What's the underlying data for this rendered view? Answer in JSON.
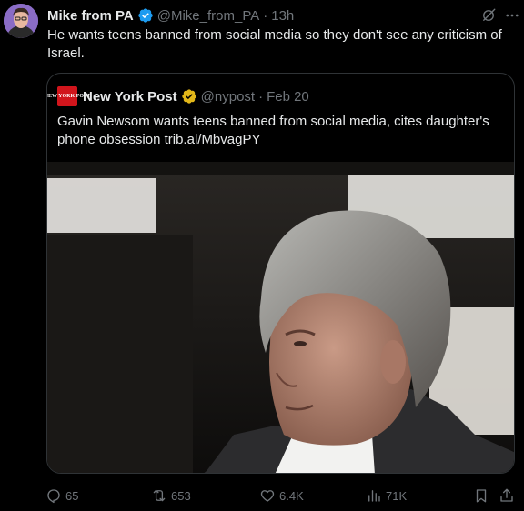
{
  "tweet": {
    "author_name": "Mike from PA",
    "handle": "@Mike_from_PA",
    "separator": "·",
    "time": "13h",
    "text": "He wants teens banned from social media so they don't see any criticism of Israel."
  },
  "quote": {
    "avatar_text": "NEW YORK POST",
    "author_name": "New York Post",
    "handle": "@nypost",
    "separator": "·",
    "time": "Feb 20",
    "text": "Gavin Newsom wants teens banned from social media, cites daughter's phone obsession trib.al/MbvagPY"
  },
  "actions": {
    "replies": "65",
    "reposts": "653",
    "likes": "6.4K",
    "views": "71K"
  },
  "icons": {
    "verified_user": "blue-verified-badge-icon",
    "verified_org": "gold-verified-badge-icon",
    "grok": "grok-icon",
    "more": "more-icon",
    "reply": "reply-icon",
    "repost": "repost-icon",
    "like": "heart-icon",
    "views": "views-icon",
    "bookmark": "bookmark-icon",
    "share": "share-icon"
  },
  "colors": {
    "background": "#000000",
    "text": "#e7e9ea",
    "secondary": "#71767b",
    "border": "#2f3336",
    "verified_blue": "#1d9bf0",
    "verified_gold": "#e2b719",
    "nypost_red": "#d1151c"
  }
}
